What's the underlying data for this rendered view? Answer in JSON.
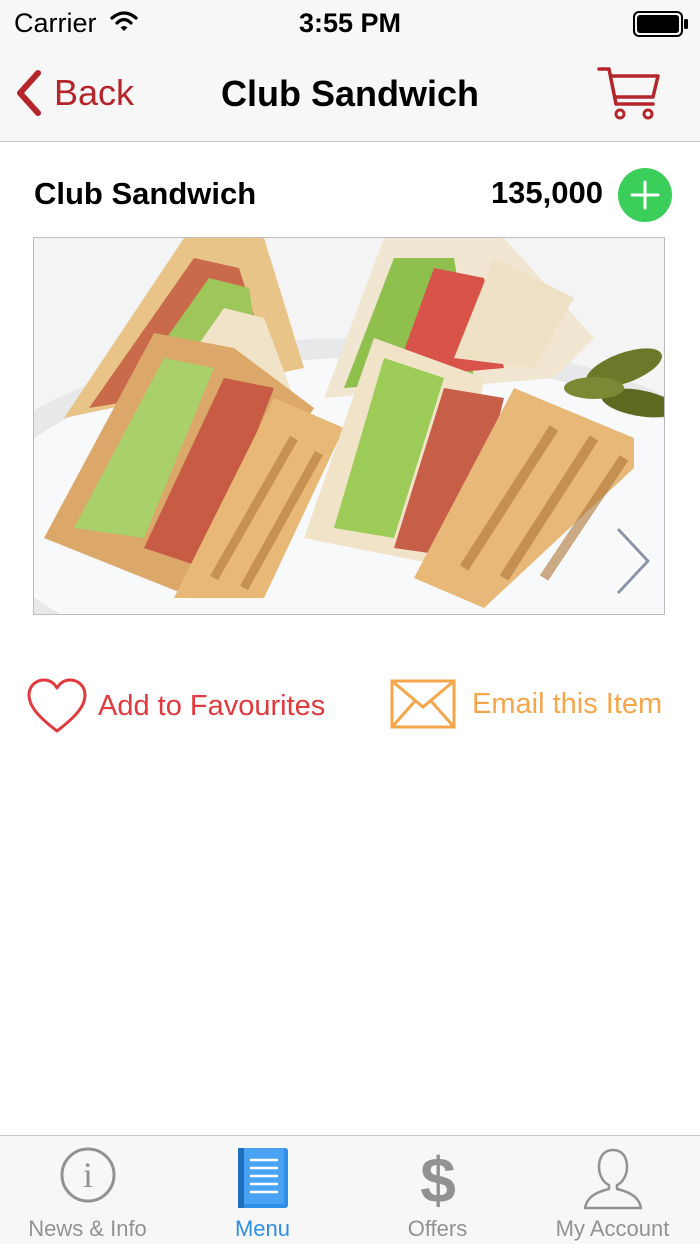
{
  "status_bar": {
    "carrier": "Carrier",
    "time": "3:55 PM"
  },
  "nav": {
    "back_label": "Back",
    "title": "Club Sandwich",
    "cart_icon": "cart-icon"
  },
  "item": {
    "name": "Club Sandwich",
    "price": "135,000",
    "add_icon": "plus-icon",
    "image_alt": "club-sandwich-photo"
  },
  "actions": {
    "favourite_label": "Add to Favourites",
    "email_label": "Email this Item"
  },
  "tabs": [
    {
      "label": "News & Info",
      "icon": "info-icon",
      "active": false
    },
    {
      "label": "Menu",
      "icon": "book-icon",
      "active": true
    },
    {
      "label": "Offers",
      "icon": "dollar-icon",
      "active": false
    },
    {
      "label": "My Account",
      "icon": "person-icon",
      "active": false
    }
  ],
  "colors": {
    "accent_red": "#b5262c",
    "add_green": "#3cce5b",
    "favourite_red": "#e0393e",
    "email_orange": "#f5a54a",
    "tab_active_blue": "#2f8ee6",
    "tab_inactive_gray": "#929292"
  }
}
